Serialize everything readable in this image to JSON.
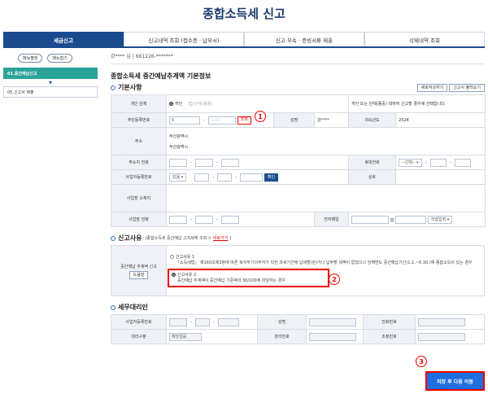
{
  "page": {
    "title": "종합소득세 신고"
  },
  "tabs": [
    {
      "label": "세금신고"
    },
    {
      "label": "신고내역 조회 (접수증 · 납부서)"
    },
    {
      "label": "신고 부속 · 증빙서류 제출"
    },
    {
      "label": "삭제내역 조회"
    }
  ],
  "sidebar": {
    "menu_expand": "메뉴펼침",
    "menu_collapse": "메뉴접기",
    "step1": "01.중간예납신고",
    "step5": "05.신고서 제출"
  },
  "header": {
    "user": "강**** 님",
    "id_number": "661226-*******"
  },
  "form": {
    "main_title": "종합소득세 중간예납추계액 기본정보",
    "basic_section": "기본사항",
    "btn_new": "새로작성하기",
    "btn_load": "신고서 불러오기",
    "row_individual_label": "개인 단체",
    "opt_individual": "개인",
    "opt_group": "단체(종중)",
    "individual_note": "개인 또는 단체(종중) 대하여 신고할 경우에 선택합니다.",
    "rrn_label": "주민등록번호",
    "rrn_first": "6",
    "rrn_second": "·······",
    "rrn_lookup_btn": "조회",
    "name_label": "성명",
    "name_value": "강****",
    "year_label": "귀속년도",
    "year_value": "2024",
    "address_label": "주소",
    "address_line1": "부산광역시 .",
    "address_line2": "부산광역시 .",
    "home_phone_label": "주소지 전화",
    "mobile_label": "휴대전화",
    "mobile_select": "--선택--",
    "bizno_label": "사업자등록번호",
    "bizno_select": "있음",
    "bizno_confirm_btn": "확인",
    "trade_name_label": "상호",
    "biz_location_label": "사업장 소재지",
    "biz_phone_label": "사업장 전화",
    "email_label": "전자메일",
    "email_at": "@",
    "email_select": "직접입력"
  },
  "reason": {
    "section_title": "신고사유",
    "sub_note": "(종합소득세 중간예납 고지세액 조회 >",
    "link": "바로가기",
    "sub_close": ")",
    "row_label": "중간예납 추계액 신고",
    "help_btn": "도움말",
    "opt1_title": "신고사유 1",
    "opt1_text": "「소득세법」 제160조제3항에 따른 복식부기의무자가 직전 과세기간에 납세할(된)거나 납부할 세액이 없었으나 당해연도 중간예납기간(1.1.~6.30.)에 종합소득이 있는 경우",
    "opt2_title": "신고사유 2",
    "opt2_text": "중간예납 추계액이 중간예납 기준액의 30/100에 미달하는 경우"
  },
  "agent": {
    "section_title": "세무대리인",
    "bizno_label": "사업자등록번호",
    "name_label": "성명",
    "phone_label": "전화번호",
    "type_label": "대리구분",
    "type_value": "해당없음",
    "mgmt_label": "관리번호",
    "adjust_label": "조정번호"
  },
  "badges": {
    "b1": "1",
    "b2": "2",
    "b3": "3"
  },
  "submit": {
    "label": "저장 후 다음 이동"
  }
}
